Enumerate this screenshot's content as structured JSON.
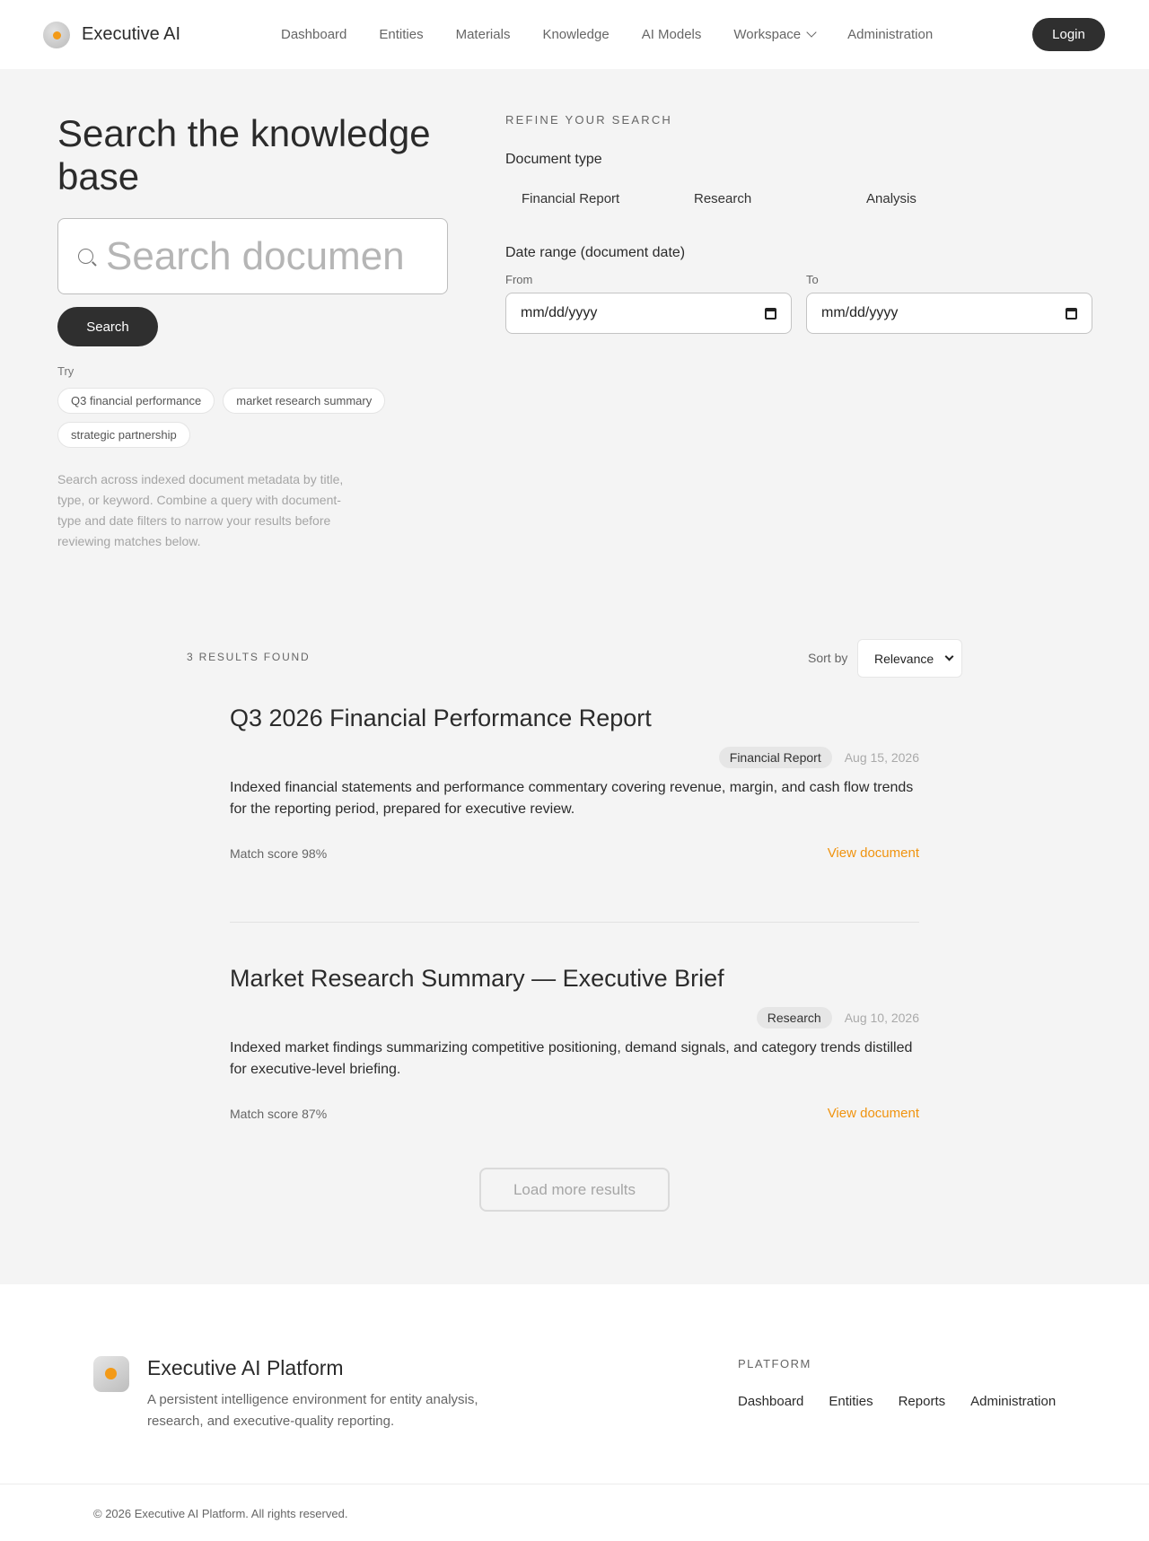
{
  "header": {
    "brand": "Executive AI",
    "nav": [
      "Dashboard",
      "Entities",
      "Materials",
      "Knowledge",
      "AI Models",
      "Workspace",
      "Administration"
    ],
    "login_label": "Login"
  },
  "search": {
    "title": "Search the knowledge base",
    "placeholder": "Search documents",
    "button_label": "Search",
    "try_label": "Try",
    "suggestions": [
      "Q3 financial performance",
      "market research summary",
      "strategic partnership"
    ],
    "helper_text": "Search across indexed document metadata by title, type, or keyword. Combine a query with document-type and date filters to narrow your results before reviewing matches below."
  },
  "filters": {
    "title": "REFINE YOUR SEARCH",
    "doc_type_label": "Document type",
    "doc_types": [
      "Financial Report",
      "Research",
      "Analysis"
    ],
    "date_label": "Date range (document date)",
    "from_label": "From",
    "to_label": "To",
    "from_value": "mm/dd/yyyy",
    "to_value": "mm/dd/yyyy"
  },
  "results": {
    "count_label": "3 RESULTS FOUND",
    "sort_label": "Sort by",
    "sort_value": "Relevance",
    "items": [
      {
        "title": "Q3 2026 Financial Performance Report",
        "type": "Financial Report",
        "date": "Aug 15, 2026",
        "description": "Indexed financial statements and performance commentary covering revenue, margin, and cash flow trends for the reporting period, prepared for executive review.",
        "score": "Match score 98%",
        "link": "View document"
      },
      {
        "title": "Market Research Summary — Executive Brief",
        "type": "Research",
        "date": "Aug 10, 2026",
        "description": "Indexed market findings summarizing competitive positioning, demand signals, and category trends distilled for executive-level briefing.",
        "score": "Match score 87%",
        "link": "View document"
      }
    ],
    "load_more_label": "Load more results"
  },
  "footer": {
    "title": "Executive AI Platform",
    "description": "A persistent intelligence environment for entity analysis, research, and executive-quality reporting.",
    "platform_label": "PLATFORM",
    "links": [
      "Dashboard",
      "Entities",
      "Reports",
      "Administration"
    ],
    "copyright": "© 2026 Executive AI Platform. All rights reserved."
  },
  "colors": {
    "accent": "#f0930f",
    "dark_button": "#2f2f2f",
    "background": "#f4f4f4"
  }
}
